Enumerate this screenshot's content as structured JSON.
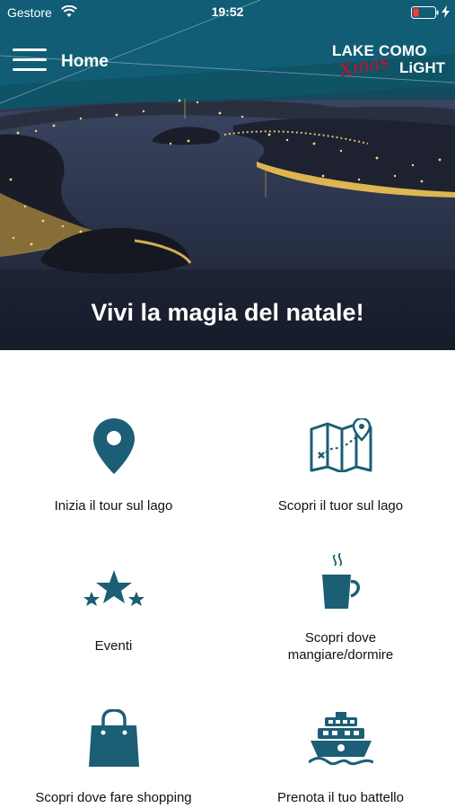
{
  "status_bar": {
    "carrier": "Gestore",
    "time": "19:52",
    "wifi_icon": "wifi-icon",
    "battery_icon": "battery-low-icon",
    "charging_icon": "bolt-icon"
  },
  "nav": {
    "menu_icon": "hamburger-menu-icon",
    "title": "Home"
  },
  "logo": {
    "line1": "LAKE COMO",
    "script": "Xmas",
    "line2": "LiGHT"
  },
  "hero": {
    "title": "Vivi la magia del natale!"
  },
  "tiles": [
    {
      "label": "Inizia il tour sul lago",
      "icon": "location-pin-icon"
    },
    {
      "label": "Scopri il tuor sul lago",
      "icon": "map-icon"
    },
    {
      "label": "Eventi",
      "icon": "stars-icon"
    },
    {
      "label": "Scopri dove mangiare/dormire",
      "icon": "coffee-cup-icon"
    },
    {
      "label": "Scopri dove fare shopping",
      "icon": "shopping-bag-icon"
    },
    {
      "label": "Prenota il tuo battello",
      "icon": "boat-icon"
    }
  ],
  "colors": {
    "accent": "#1b5e75",
    "logo_red": "#c8102e",
    "header_teal": "#0f5366"
  }
}
